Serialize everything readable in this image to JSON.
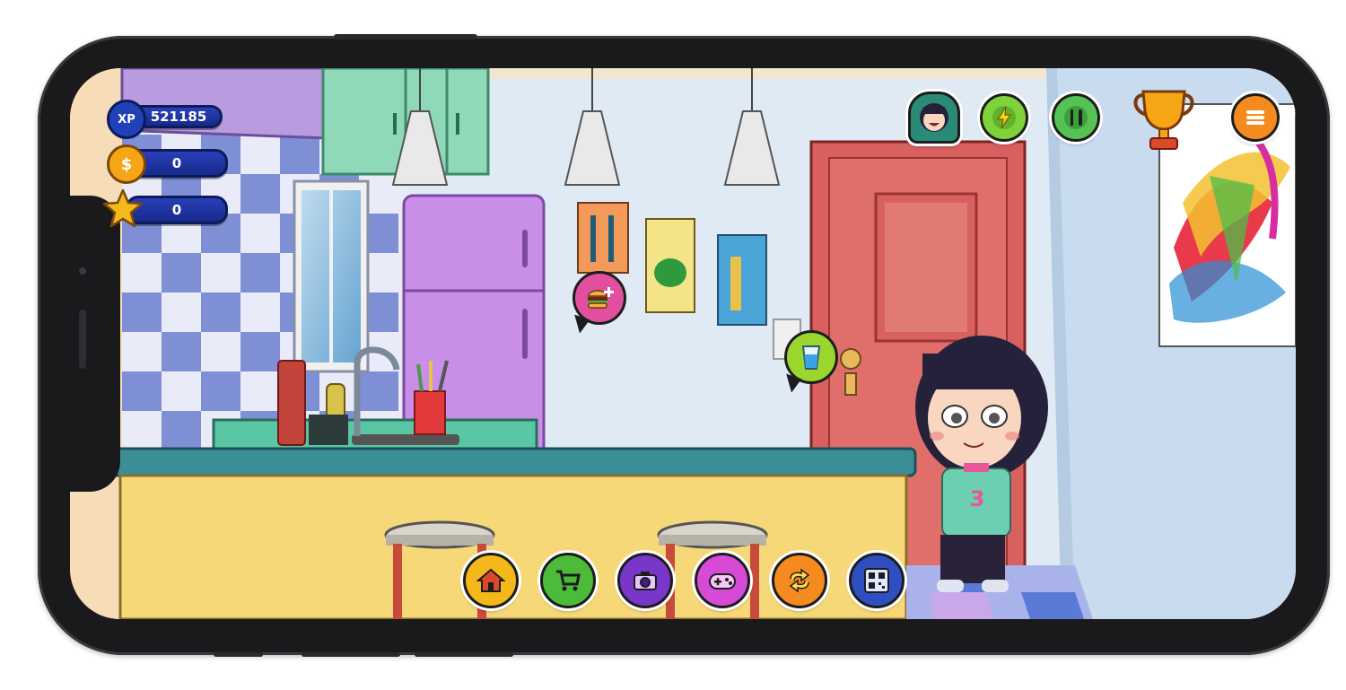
{
  "hud": {
    "xp_label": "XP",
    "xp_value": "521185",
    "coins_symbol": "$",
    "coins_value": "0",
    "stars_value": "0"
  },
  "top_buttons": [
    {
      "name": "avatar-button",
      "icon": "girl-face-icon"
    },
    {
      "name": "energy-button",
      "icon": "lightning-icon"
    },
    {
      "name": "food-button",
      "icon": "fork-knife-icon"
    },
    {
      "name": "trophy-button",
      "icon": "trophy-icon"
    },
    {
      "name": "menu-button",
      "icon": "hamburger-menu-icon"
    }
  ],
  "bottom_toolbar": [
    {
      "name": "home-button",
      "icon": "house-icon",
      "color": "#f4b81a"
    },
    {
      "name": "shop-button",
      "icon": "cart-icon",
      "color": "#4dbb3a"
    },
    {
      "name": "camera-button",
      "icon": "camera-icon",
      "color": "#7a36c9"
    },
    {
      "name": "games-button",
      "icon": "gamepad-icon",
      "color": "#d64ad6"
    },
    {
      "name": "exchange-button",
      "icon": "swap-icon",
      "color": "#f58a1f"
    },
    {
      "name": "qr-button",
      "icon": "qr-code-icon",
      "color": "#2f4fc1"
    }
  ],
  "scene_actions": [
    {
      "name": "eat-bubble",
      "icon": "burger-plus-icon",
      "color": "#e24f9e"
    },
    {
      "name": "drink-bubble",
      "icon": "water-glass-icon",
      "color": "#9ad62b"
    }
  ],
  "character": {
    "shirt_number": "3"
  },
  "colors": {
    "hud_blue": "#1f33a6",
    "coin_gold": "#f6a516",
    "door_red": "#d8605e",
    "fridge_purple": "#c88ee8",
    "counter_teal": "#3a8f97",
    "counter_yellow": "#f7d878"
  }
}
